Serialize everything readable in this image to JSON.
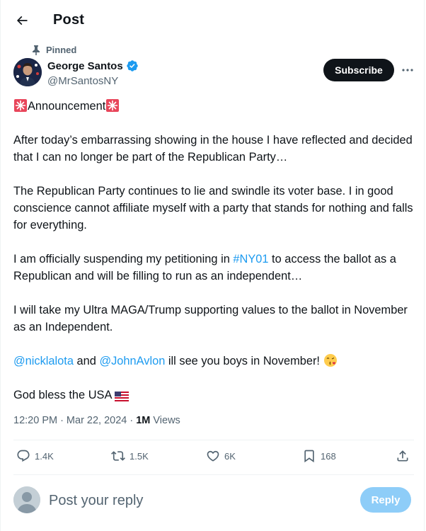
{
  "header": {
    "title": "Post"
  },
  "pinned_label": "Pinned",
  "author": {
    "display_name": "George Santos",
    "handle": "@MrSantosNY",
    "verified_color": "#1d9bf0"
  },
  "subscribe_label": "Subscribe",
  "tweet": {
    "title_text": "Announcement",
    "p1": "After today’s embarrassing showing in the house I have reflected and decided that I can no longer be part of the Republican Party…",
    "p2": "The Republican Party continues to lie and swindle its voter base. I in good conscience cannot affiliate myself with a party that stands for nothing and falls for everything.",
    "p3_before": "I am officially suspending my petitioning in ",
    "p3_hashtag": "#NY01",
    "p3_after": " to access the ballot as a Republican and will be filling to run as an independent…",
    "p4": "I will take my Ultra MAGA/Trump supporting values to the ballot in November as an Independent.",
    "p5_mention1": "@nicklalota",
    "p5_and": " and ",
    "p5_mention2": "@JohnAvlon",
    "p5_after": " ill see you boys in November! ",
    "p6": "God bless the USA "
  },
  "meta": {
    "time": "12:20 PM",
    "separator1": " · ",
    "date": "Mar 22, 2024",
    "separator2": " · ",
    "views_count": "1M",
    "views_label": "Views"
  },
  "actions": {
    "replies": "1.4K",
    "reposts": "1.5K",
    "likes": "6K",
    "bookmarks": "168"
  },
  "reply_box": {
    "placeholder": "Post your reply",
    "button_label": "Reply"
  },
  "colors": {
    "accent": "#1d9bf0",
    "text": "#0f1419",
    "muted": "#536471",
    "reply_disabled": "#8ecdf8"
  }
}
